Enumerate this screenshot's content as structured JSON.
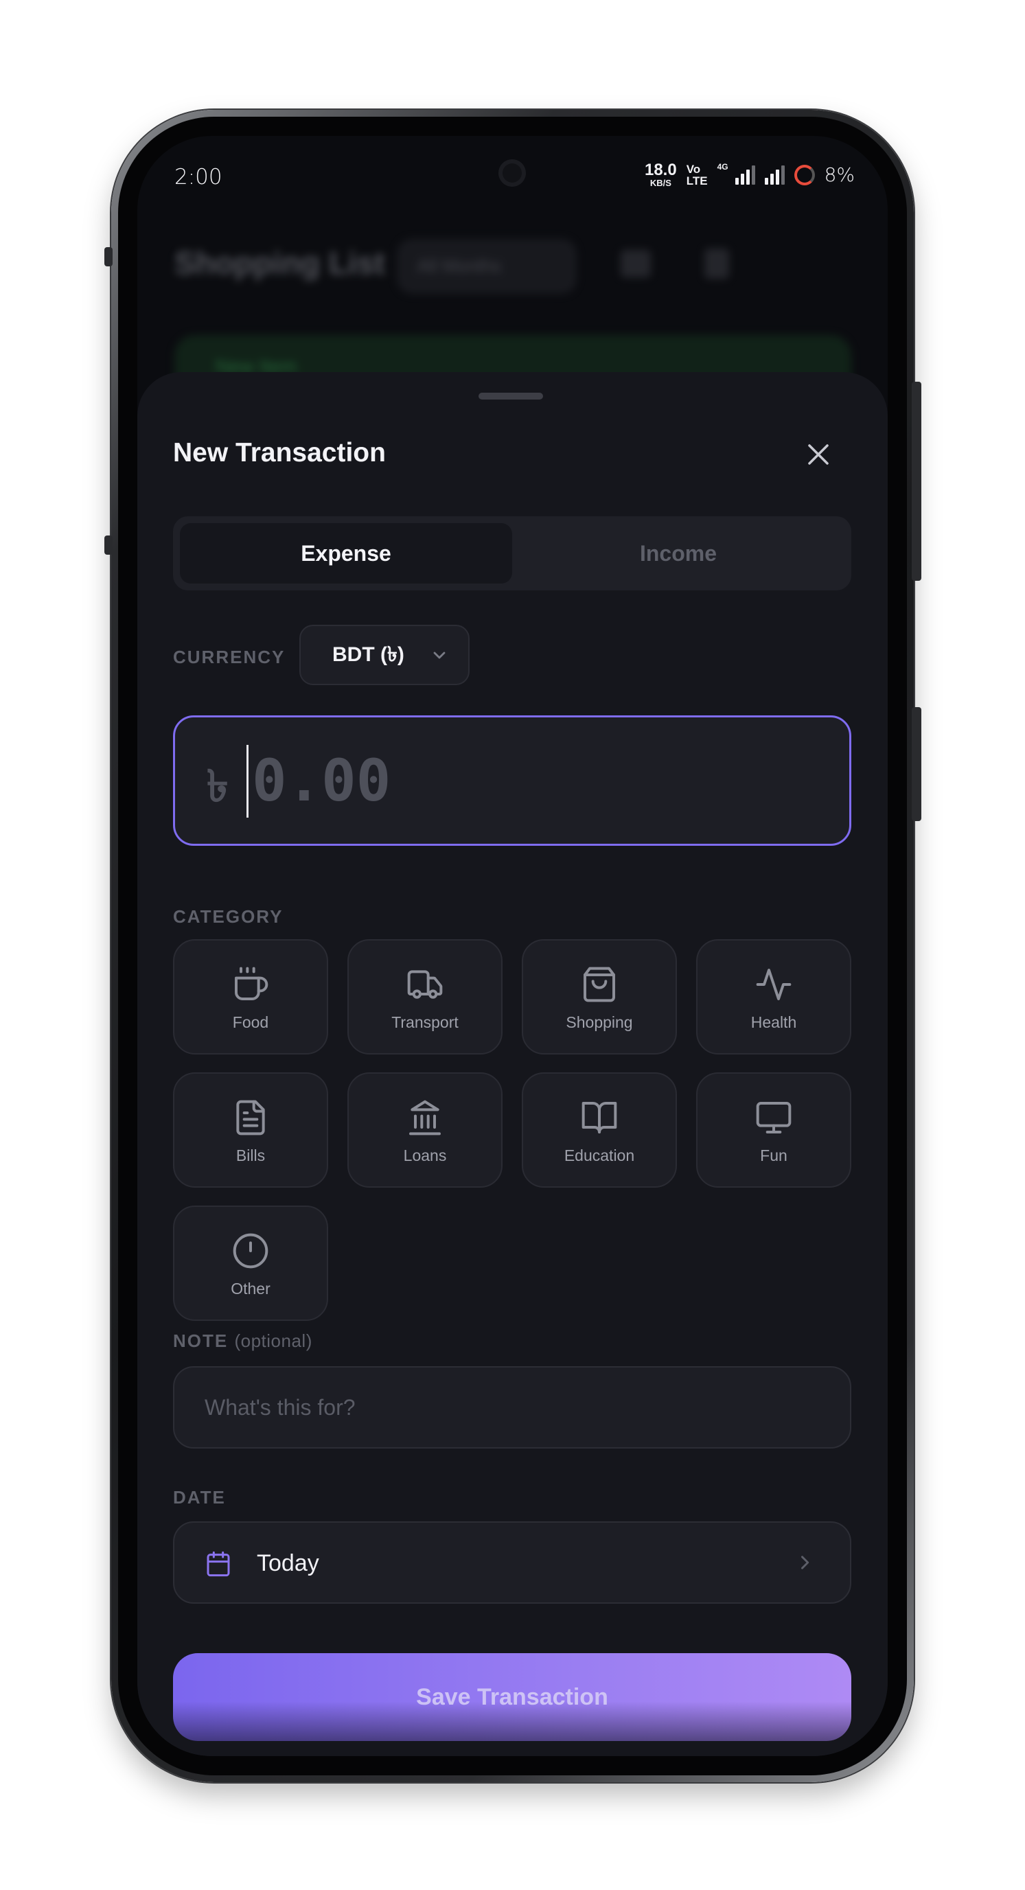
{
  "status_bar": {
    "time": "2:00",
    "net_speed_value": "18.0",
    "net_speed_unit": "KB/S",
    "volte_top": "Vo ",
    "volte_bottom": "LTE",
    "network_tag": "4G",
    "battery_percent": "8%"
  },
  "background_app": {
    "title": "Shopping List",
    "filter_chip": "All Months",
    "banner_text": "New Item"
  },
  "sheet": {
    "title": "New Transaction",
    "close_icon": "close-icon",
    "type_toggle": {
      "options": [
        "Expense",
        "Income"
      ],
      "selected": "Expense"
    },
    "currency": {
      "label": "CURRENCY",
      "value": "BDT (৳)"
    },
    "amount": {
      "symbol": "৳",
      "value": "",
      "placeholder": "0.00"
    },
    "category": {
      "label": "CATEGORY",
      "items": [
        {
          "name": "Food",
          "icon": "coffee-cup-icon"
        },
        {
          "name": "Transport",
          "icon": "truck-icon"
        },
        {
          "name": "Shopping",
          "icon": "shopping-bag-icon"
        },
        {
          "name": "Health",
          "icon": "activity-pulse-icon"
        },
        {
          "name": "Bills",
          "icon": "document-icon"
        },
        {
          "name": "Loans",
          "icon": "bank-icon"
        },
        {
          "name": "Education",
          "icon": "open-book-icon"
        },
        {
          "name": "Fun",
          "icon": "monitor-icon"
        },
        {
          "name": "Other",
          "icon": "alert-circle-icon"
        }
      ]
    },
    "note": {
      "label": "NOTE",
      "optional": "(optional)",
      "value": "",
      "placeholder": "What's this for?"
    },
    "date": {
      "label": "DATE",
      "value": "Today",
      "icon": "calendar-icon"
    },
    "save_label": "Save Transaction"
  },
  "colors": {
    "accent": "#7f6cf0",
    "sheet_bg": "#15161c",
    "card_bg": "#1d1e25",
    "muted_text": "#5f616b"
  }
}
